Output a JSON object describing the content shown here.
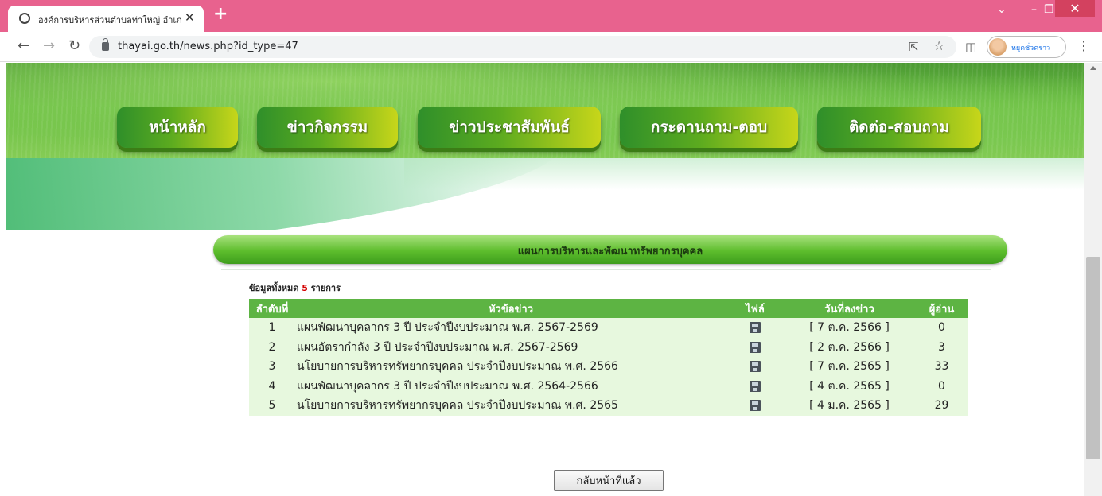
{
  "browser": {
    "tab_title": "องค์การบริหารส่วนตำบลท่าใหญ่ อำเภอ",
    "tab_close": "✕",
    "new_tab": "+",
    "url": "thayai.go.th/news.php?id_type=47",
    "profile_name": "หยุดชั่วคราว",
    "theme_color": "#e8628e"
  },
  "nav_menu": [
    {
      "label": "หน้าหลัก"
    },
    {
      "label": "ข่าวกิจกรรม"
    },
    {
      "label": "ข่าวประชาสัมพันธ์"
    },
    {
      "label": "กระดานถาม-ตอบ"
    },
    {
      "label": "ติดต่อ-สอบถาม"
    }
  ],
  "panel": {
    "title": "แผนการบริหารและพัฒนาทรัพยากรบุคคล",
    "summary_prefix": "ข้อมูลทั้งหมด",
    "summary_count": "5",
    "summary_suffix": "รายการ"
  },
  "table": {
    "headers": {
      "no": "ลำดับที่",
      "title": "หัวข้อข่าว",
      "file": "ไฟล์",
      "date": "วันที่ลงข่าว",
      "readers": "ผู้อ่าน"
    },
    "rows": [
      {
        "no": "1",
        "title": "แผนพัฒนาบุคลากร 3 ปี ประจำปีงบประมาณ พ.ศ. 2567-2569",
        "date": "[ 7 ต.ค. 2566 ]",
        "readers": "0",
        "file_icon": "save-icon"
      },
      {
        "no": "2",
        "title": "แผนอัตรากำลัง 3 ปี ประจำปีงบประมาณ พ.ศ. 2567-2569",
        "date": "[ 2 ต.ค. 2566 ]",
        "readers": "3",
        "file_icon": "save-icon"
      },
      {
        "no": "3",
        "title": "นโยบายการบริหารทรัพยากรบุคคล ประจำปีงบประมาณ พ.ศ. 2566",
        "date": "[ 7 ต.ค. 2565 ]",
        "readers": "33",
        "file_icon": "save-icon"
      },
      {
        "no": "4",
        "title": "แผนพัฒนาบุคลากร 3 ปี ประจำปีงบประมาณ พ.ศ. 2564-2566",
        "date": "[ 4 ต.ค. 2565 ]",
        "readers": "0",
        "file_icon": "save-icon"
      },
      {
        "no": "5",
        "title": "นโยบายการบริหารทรัพยากรบุคคล ประจำปีงบประมาณ พ.ศ. 2565",
        "date": "[ 4 ม.ค. 2565 ]",
        "readers": "29",
        "file_icon": "save-icon"
      }
    ]
  },
  "back_button": "กลับหน้าที่แล้ว",
  "colors": {
    "table_header": "#5db443",
    "table_row": "#e7f8de",
    "count_highlight": "#d40000"
  }
}
